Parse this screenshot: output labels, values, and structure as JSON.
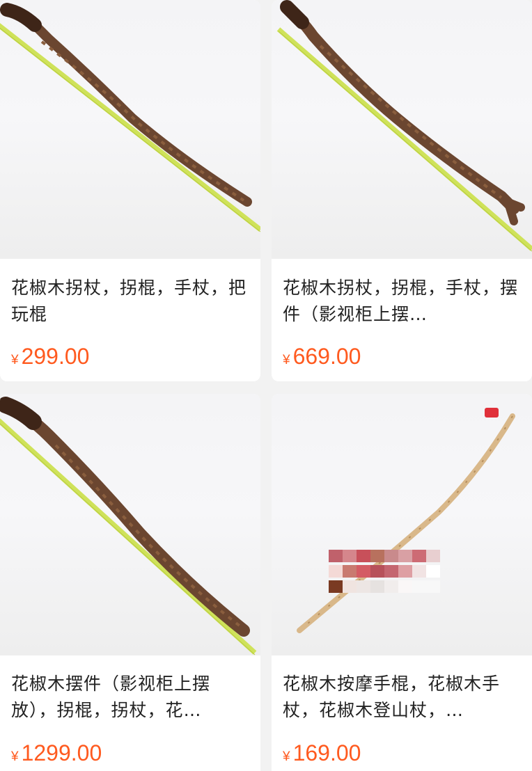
{
  "products": [
    {
      "title": "花椒木拐杖，拐棍，手杖，把玩棍",
      "currency": "¥",
      "price": "299.00"
    },
    {
      "title": "花椒木拐杖，拐棍，手杖，摆件（影视柜上摆…",
      "currency": "¥",
      "price": "669.00"
    },
    {
      "title": "花椒木摆件（影视柜上摆放），拐棍，拐杖，花…",
      "currency": "¥",
      "price": "1299.00"
    },
    {
      "title": "花椒木按摩手棍，花椒木手杖，花椒木登山杖，…",
      "currency": "¥",
      "price": "169.00"
    }
  ],
  "colors": {
    "price": "#ff5a1f",
    "ruler": "#c8e04a",
    "wood_dark": "#6b4630",
    "wood_light": "#d9b88a"
  }
}
